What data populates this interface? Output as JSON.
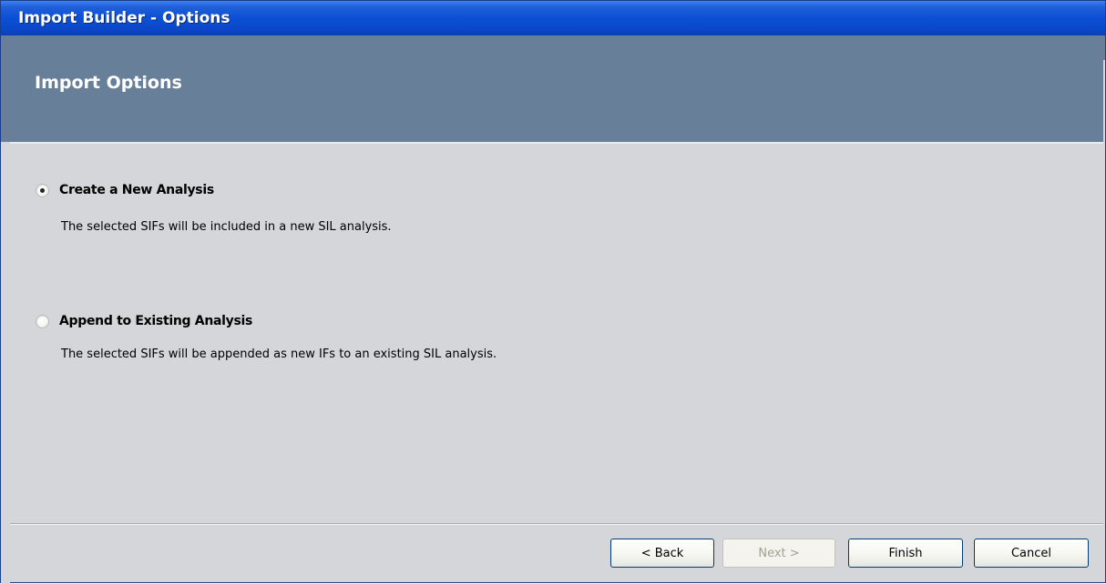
{
  "window": {
    "title": "Import Builder - Options"
  },
  "header": {
    "title": "Import Options"
  },
  "options": [
    {
      "label": "Create a New Analysis",
      "description": "The selected SIFs will be included in a new SIL analysis.",
      "selected": true
    },
    {
      "label": "Append to Existing Analysis",
      "description": "The selected SIFs will be appended as new IFs to an existing SIL analysis.",
      "selected": false
    }
  ],
  "buttons": {
    "back": "< Back",
    "next": "Next >",
    "finish": "Finish",
    "cancel": "Cancel"
  },
  "colors": {
    "titlebar": "#0c4fd6",
    "header_band": "#687f9a",
    "body": "#d4d6da"
  }
}
